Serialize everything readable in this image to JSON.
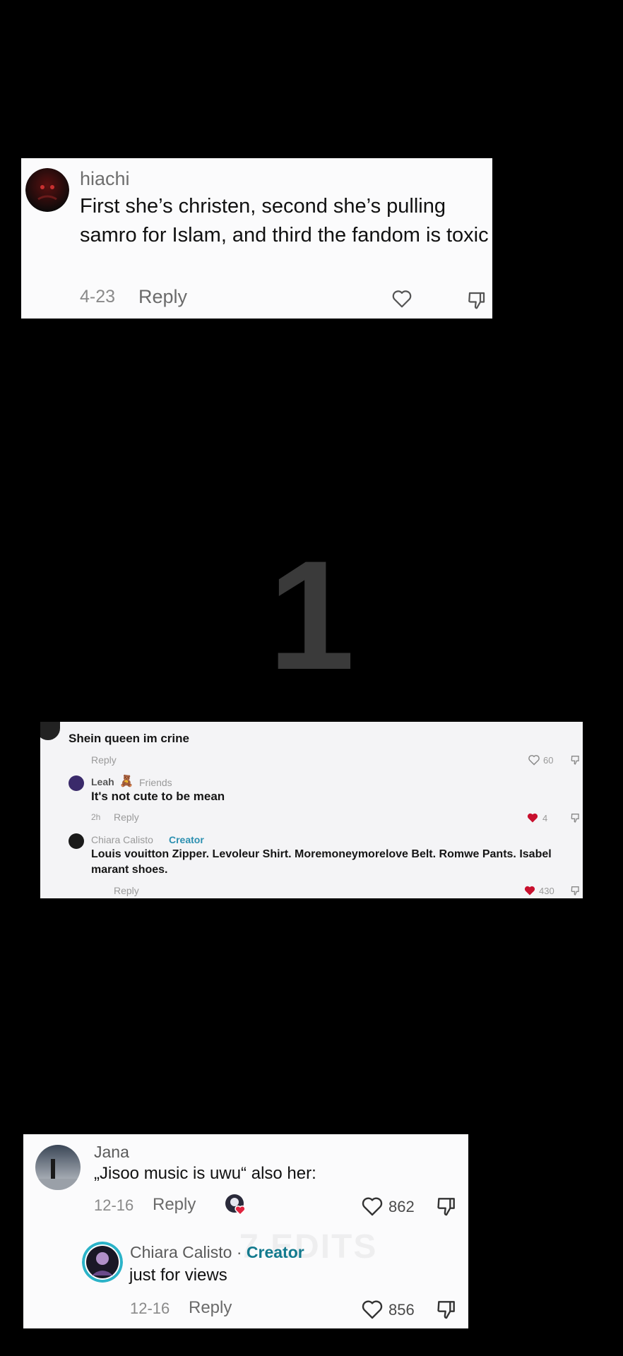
{
  "card1": {
    "username": "hiachi",
    "comment": "First she’s christen, second she’s pulling samro for Islam, and third the fandom is toxic",
    "date": "4-23",
    "reply_label": "Reply"
  },
  "big_number": "1",
  "card2": {
    "comment1": {
      "text": "Shein queen im crine",
      "reply_label": "Reply",
      "likes": "60"
    },
    "comment2": {
      "user": "Leah",
      "friends_label": "Friends",
      "text": "It's not cute to be mean",
      "time": "2h",
      "reply_label": "Reply",
      "likes": "4"
    },
    "comment3": {
      "user": "Chiara Calisto",
      "creator_label": "Creator",
      "text": "Louis vouitton Zipper. Levoleur Shirt. Moremoneymorelove Belt. Romwe Pants. Isabel marant shoes.",
      "reply_label": "Reply",
      "likes": "430"
    }
  },
  "card3": {
    "comment1": {
      "user": "Jana",
      "text": "„Jisoo music is uwu“ also her:",
      "date": "12-16",
      "reply_label": "Reply",
      "likes": "862"
    },
    "reply": {
      "user": "Chiara Calisto",
      "separator": " · ",
      "creator_label": "Creator",
      "text": "just for views",
      "date": "12-16",
      "reply_label": "Reply",
      "likes": "856"
    },
    "watermark": "7 EDITS"
  },
  "colors": {
    "background": "#000000",
    "card": "#fbfbfc",
    "creator_accent": "#137a8e",
    "like_red": "#e0243f"
  }
}
